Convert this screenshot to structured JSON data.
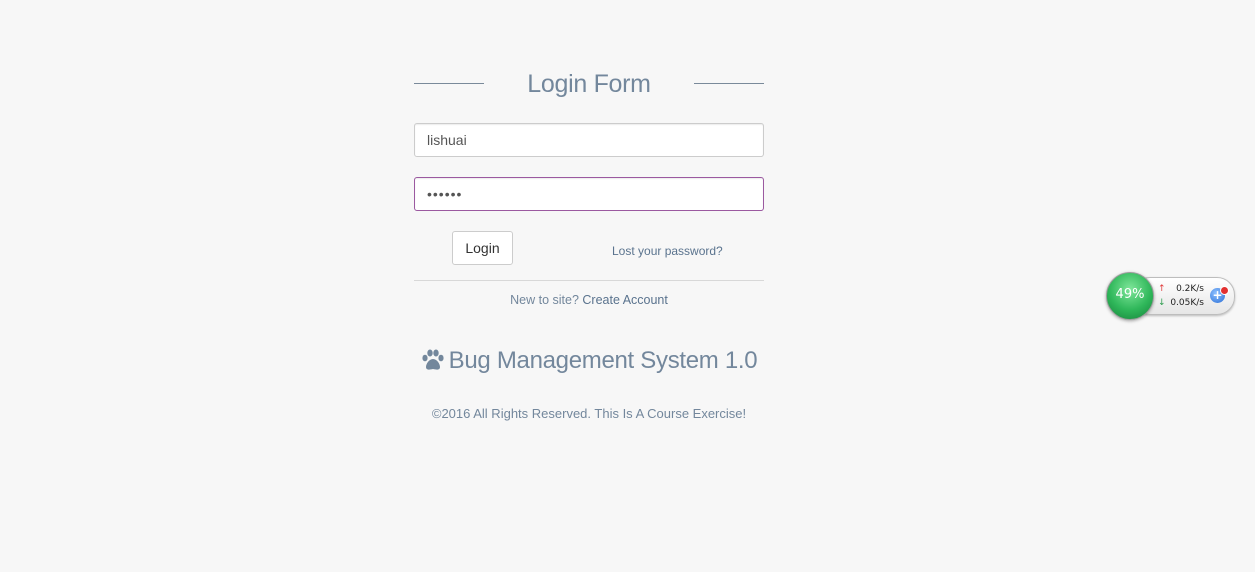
{
  "form": {
    "title": "Login Form",
    "username_value": "lishuai",
    "password_mask": "••••••",
    "login_label": "Login",
    "lost_password": "Lost your password?",
    "new_to_site": "New to site?",
    "create_account": "Create Account"
  },
  "brand": {
    "icon": "paw-icon",
    "name": "Bug Management System 1.0"
  },
  "footer": {
    "copyright": "©2016 All Rights Reserved. This Is A Course Exercise!"
  },
  "net_widget": {
    "percent": "49%",
    "upload": "0.2K/s",
    "download": "0.05K/s",
    "colors": {
      "ball": "#2fb75a",
      "up": "#e03a3a",
      "down": "#2e9d4e"
    }
  },
  "colors": {
    "background": "#f7f7f7",
    "text": "#73879c",
    "focus_border": "#9b59a0"
  }
}
